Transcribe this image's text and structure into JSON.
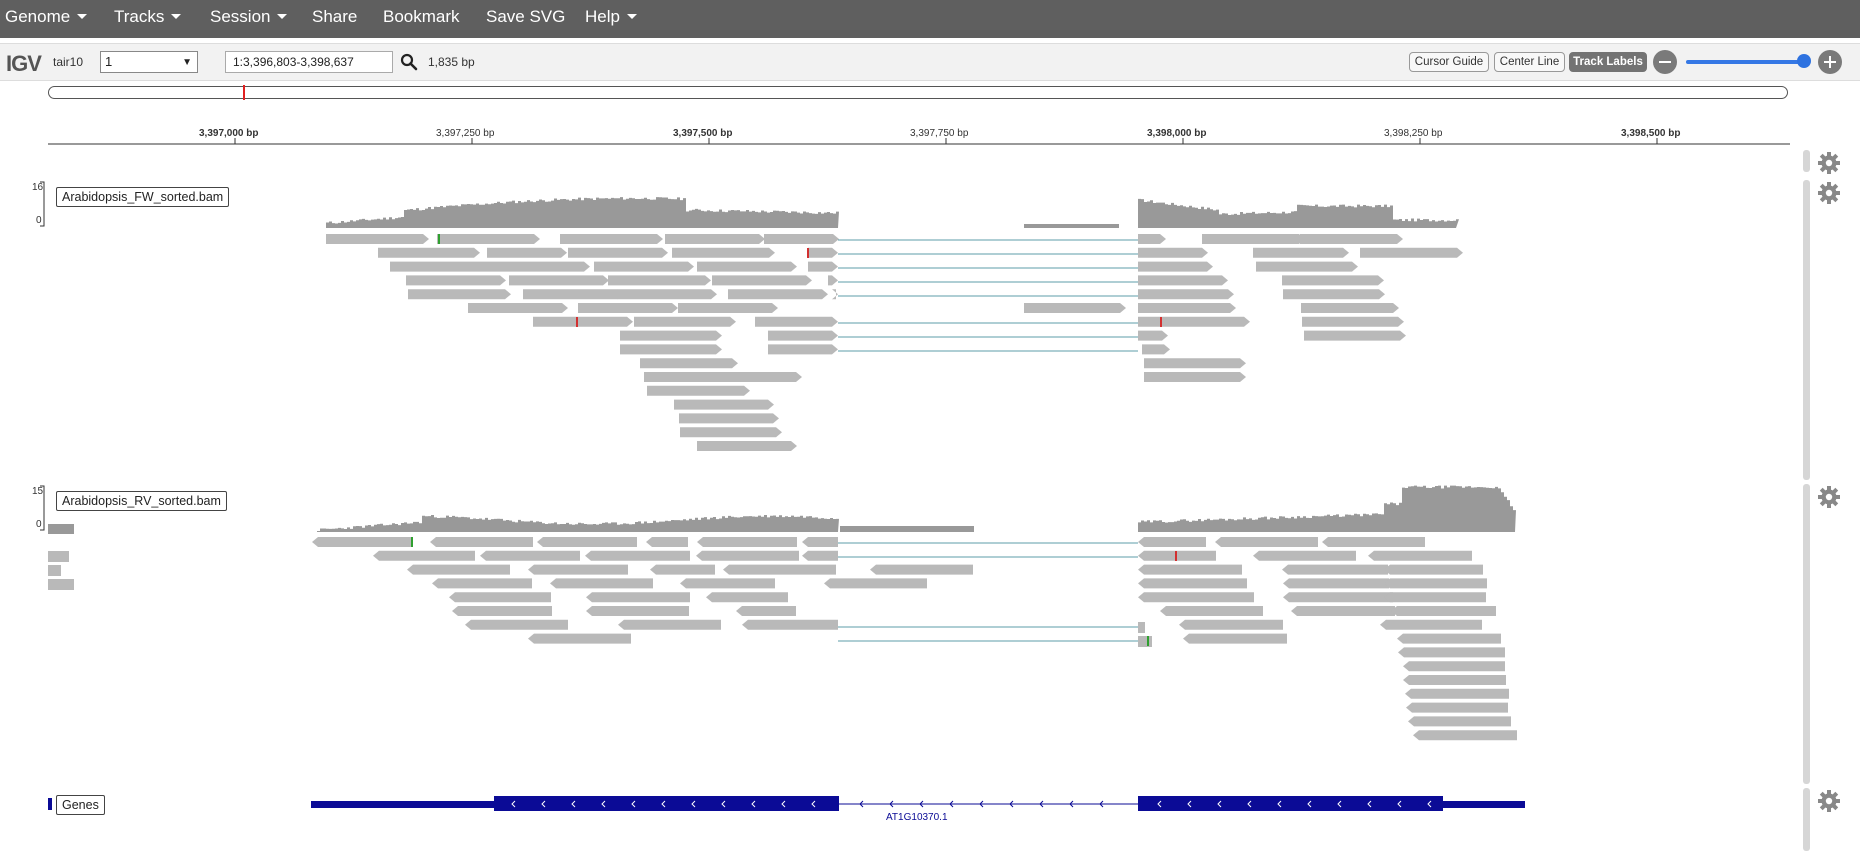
{
  "menu": [
    {
      "label": "Genome",
      "dropdown": true
    },
    {
      "label": "Tracks",
      "dropdown": true
    },
    {
      "label": "Session",
      "dropdown": true
    },
    {
      "label": "Share",
      "dropdown": false
    },
    {
      "label": "Bookmark",
      "dropdown": false
    },
    {
      "label": "Save SVG",
      "dropdown": false
    },
    {
      "label": "Help",
      "dropdown": true
    }
  ],
  "navbar": {
    "logo": "IGV",
    "genome": "tair10",
    "chromosome": "1",
    "locus": "1:3,396,803-3,398,637",
    "span": "1,835 bp",
    "buttons": {
      "cursor_guide": "Cursor Guide",
      "center_line": "Center Line",
      "track_labels": "Track Labels"
    },
    "zoom_level": 0.95
  },
  "ruler": {
    "ticks": [
      "3,397,000 bp",
      "3,397,250 bp",
      "3,397,500 bp",
      "3,397,750 bp",
      "3,398,000 bp",
      "3,398,250 bp",
      "3,398,500 bp"
    ]
  },
  "tracks": [
    {
      "name": "Arabidopsis_FW_sorted.bam",
      "range_max": "16",
      "range_min": "0"
    },
    {
      "name": "Arabidopsis_RV_sorted.bam",
      "range_max": "15",
      "range_min": "0"
    },
    {
      "name": "Genes",
      "feature_name": "AT1G10370.1"
    }
  ],
  "colors": {
    "menubar": "#5f5f5f",
    "coverage": "#999999",
    "read": "#b9b9b9",
    "junction_line": "#5c9ea8",
    "gene": "#0b0b96",
    "mismatch_red": "#d23030",
    "mismatch_green": "#30a030"
  },
  "icons": {
    "search": "search-icon",
    "settings": "gear-icon",
    "zoom_in": "plus-icon",
    "zoom_out": "minus-icon"
  }
}
